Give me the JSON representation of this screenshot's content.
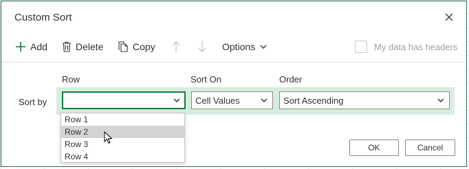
{
  "dialog": {
    "title": "Custom Sort"
  },
  "toolbar": {
    "add_label": "Add",
    "delete_label": "Delete",
    "copy_label": "Copy",
    "options_label": "Options",
    "headers_label": "My data has headers",
    "headers_checked": false
  },
  "columns": {
    "row": "Row",
    "sort_on": "Sort On",
    "order": "Order"
  },
  "sort_by": {
    "label": "Sort by",
    "row_value": "",
    "sort_on_value": "Cell Values",
    "order_value": "Sort Ascending"
  },
  "dropdown": {
    "items": [
      "Row 1",
      "Row 2",
      "Row 3",
      "Row 4"
    ],
    "hovered_index": 1
  },
  "footer": {
    "ok_label": "OK",
    "cancel_label": "Cancel"
  },
  "colors": {
    "accent": "#107c41",
    "row_highlight": "#d7ede0",
    "hover": "#d4d4d4"
  },
  "icons": [
    "close-icon",
    "plus-icon",
    "trash-icon",
    "copy-icon",
    "arrow-up-icon",
    "arrow-down-icon",
    "chevron-down-icon",
    "checkbox-icon",
    "mouse-pointer-icon"
  ]
}
